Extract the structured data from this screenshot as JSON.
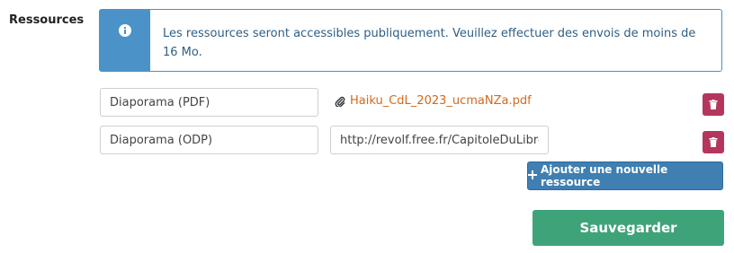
{
  "section_label": "Ressources",
  "info": {
    "icon": "info-icon",
    "message": "Les ressources seront accessibles publiquement. Veuillez effectuer des envois de moins de 16 Mo."
  },
  "resources": [
    {
      "title": "Diaporama (PDF)",
      "file_name": "Haiku_CdL_2023_ucmaNZa.pdf"
    },
    {
      "title": "Diaporama (ODP)",
      "url": "http://revolf.free.fr/CapitoleDuLibre"
    }
  ],
  "add_button_label": "Ajouter une nouvelle ressource",
  "save_button_label": "Sauvegarder",
  "colors": {
    "info_accent": "#4a92c7",
    "link": "#d2691e",
    "delete": "#b5365d",
    "add": "#3f7fb2",
    "save": "#3fa37a"
  }
}
